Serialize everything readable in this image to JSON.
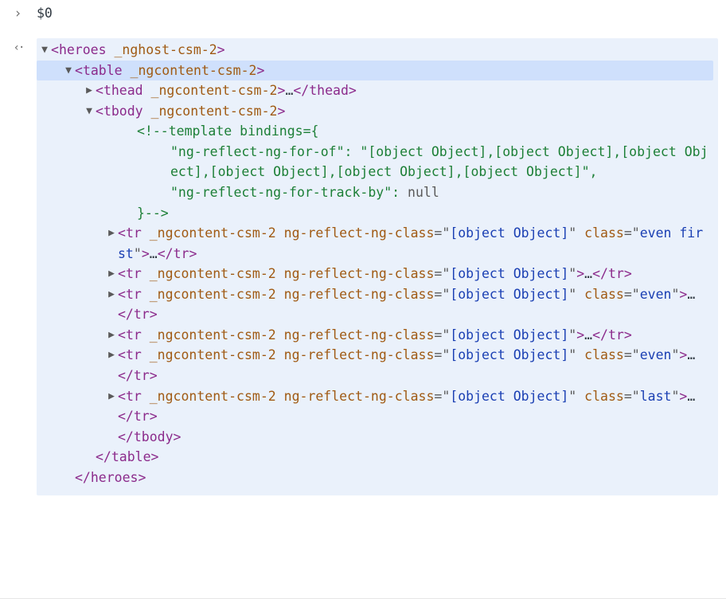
{
  "console_output": "$0",
  "arrows": {
    "down": "▼",
    "right": "▶"
  },
  "gutter_prompt": "›",
  "gutter_back": "‹·",
  "null_str": "null",
  "ellipsis": "…",
  "tags": {
    "heroes": "heroes",
    "table": "table",
    "thead": "thead",
    "tbody": "tbody",
    "tr": "tr"
  },
  "attrs": {
    "nghost": "_nghost-csm-2",
    "ngcontent": "_ngcontent-csm-2",
    "ng_reflect_class": "ng-reflect-ng-class",
    "class_attr": "class"
  },
  "vals": {
    "object": "[object Object]",
    "even_first": "even first",
    "even": "even",
    "last": "last"
  },
  "comment_lines": {
    "l1": "<!--template bindings={",
    "l2_pre": "\"ng-reflect-ng-for-of\": \"",
    "l2_objs": "[object Object],[object Object],[object Object],[object Object],[object Object],[object Object]",
    "l2_post": "\",",
    "l3_pre": "\"ng-reflect-ng-for-track-by\": ",
    "l4": "}-->"
  }
}
